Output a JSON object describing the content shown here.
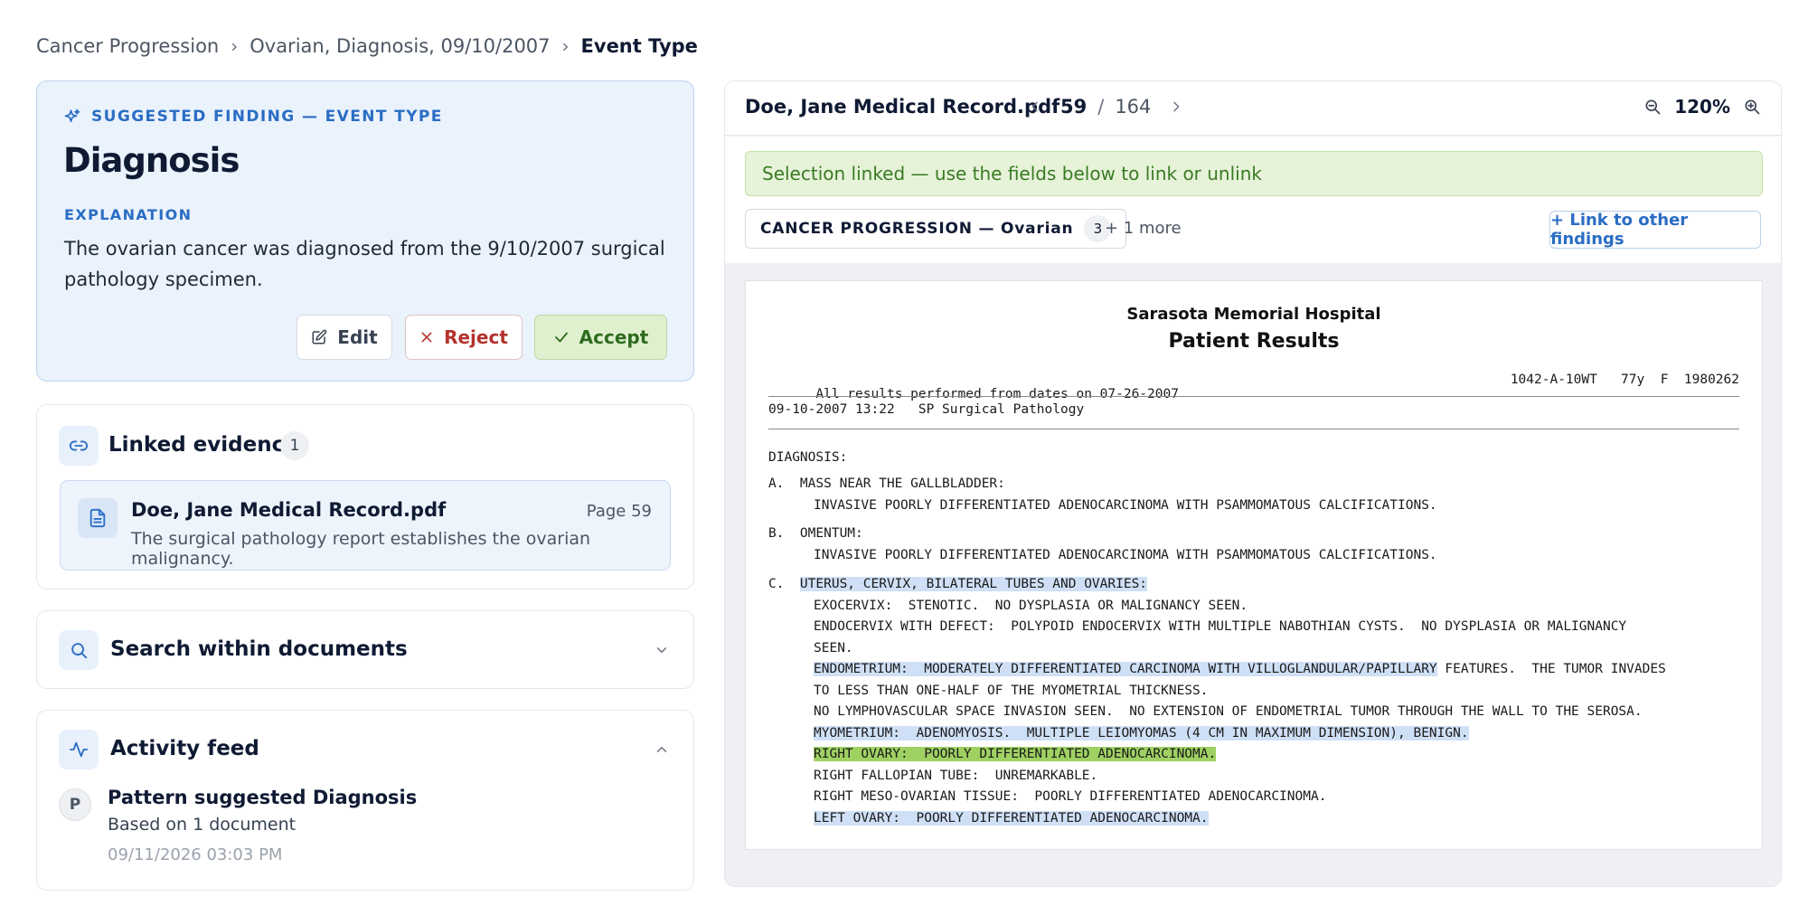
{
  "breadcrumb": {
    "items": [
      "Cancer Progression",
      "Ovarian, Diagnosis, 09/10/2007"
    ],
    "current": "Event Type"
  },
  "finding": {
    "tag": "SUGGESTED FINDING — EVENT TYPE",
    "title": "Diagnosis",
    "explanation_label": "EXPLANATION",
    "explanation": "The ovarian cancer was diagnosed from the 9/10/2007 surgical pathology specimen.",
    "actions": {
      "edit": "Edit",
      "reject": "Reject",
      "accept": "Accept"
    }
  },
  "linked_evidence": {
    "title": "Linked evidence",
    "count": "1",
    "item": {
      "file": "Doe, Jane Medical Record.pdf",
      "page": "Page 59",
      "description": "The surgical pathology report establishes the ovarian malignancy."
    }
  },
  "search": {
    "title": "Search within documents"
  },
  "activity": {
    "title": "Activity feed",
    "item": {
      "avatar": "P",
      "title": "Pattern suggested Diagnosis",
      "subtitle": "Based on 1 document",
      "time": "09/11/2026 03:03 PM"
    }
  },
  "viewer": {
    "file": "Doe, Jane Medical Record.pdf",
    "page_current": "59",
    "page_separator": "/",
    "page_total": "164",
    "zoom": "120%",
    "banner": "Selection linked — use the fields below to link or unlink",
    "chip_label": "CANCER PROGRESSION — Ovarian",
    "chip_count": "3",
    "more": "+ 1 more",
    "link_button": "+ Link to other findings"
  },
  "document": {
    "hospital": "Sarasota Memorial Hospital",
    "heading": "Patient Results",
    "header_left": "All results performed from dates on 07-26-2007",
    "header_right": "1042-A-10WT   77y  F  1980262",
    "header_line2": "09-10-2007 13:22   SP Surgical Pathology",
    "diagnosis_label": "DIAGNOSIS:",
    "a_label": "A.  MASS NEAR THE GALLBLADDER:",
    "a_text": "INVASIVE POORLY DIFFERENTIATED ADENOCARCINOMA WITH PSAMMOMATOUS CALCIFICATIONS.",
    "b_label": "B.  OMENTUM:",
    "b_text": "INVASIVE POORLY DIFFERENTIATED ADENOCARCINOMA WITH PSAMMOMATOUS CALCIFICATIONS.",
    "c_prefix": "C.  ",
    "c_label": "UTERUS, CERVIX, BILATERAL TUBES AND OVARIES:",
    "exocervix": "EXOCERVIX:  STENOTIC.  NO DYSPLASIA OR MALIGNANCY SEEN.",
    "endocervix_1": "ENDOCERVIX WITH DEFECT:  POLYPOID ENDOCERVIX WITH MULTIPLE NABOTHIAN CYSTS.  NO DYSPLASIA OR MALIGNANCY",
    "endocervix_2": "SEEN.",
    "endometrium_hl": "ENDOMETRIUM:  MODERATELY DIFFERENTIATED CARCINOMA WITH VILLOGLANDULAR/PAPILLARY",
    "endometrium_rest": " FEATURES.  THE TUMOR INVADES",
    "endometrium_2": "TO LESS THAN ONE-HALF OF THE MYOMETRIAL THICKNESS.",
    "lymph": "NO LYMPHOVASCULAR SPACE INVASION SEEN.  NO EXTENSION OF ENDOMETRIAL TUMOR THROUGH THE WALL TO THE SEROSA.",
    "myometrium": "MYOMETRIUM:  ADENOMYOSIS.  MULTIPLE LEIOMYOMAS (4 CM IN MAXIMUM DIMENSION), BENIGN.",
    "right_ovary": "RIGHT OVARY:  POORLY DIFFERENTIATED ADENOCARCINOMA.",
    "right_tube": "RIGHT FALLOPIAN TUBE:  UNREMARKABLE.",
    "right_meso": "RIGHT MESO-OVARIAN TISSUE:  POORLY DIFFERENTIATED ADENOCARCINOMA.",
    "left_ovary": "LEFT OVARY:  POORLY DIFFERENTIATED ADENOCARCINOMA."
  },
  "icons": {
    "breadcrumb_separator": "chevron-right-icon",
    "finding_tag": "sparkle-icon",
    "edit": "pencil-icon",
    "reject": "x-icon",
    "accept": "check-icon",
    "linked_evidence": "link-icon",
    "file": "file-text-icon",
    "search": "search-icon",
    "activity": "pulse-icon",
    "zoom_out": "zoom-out-icon",
    "zoom_in": "zoom-in-icon"
  },
  "colors": {
    "accent": "#2a6dc4",
    "accept": "#2f6b1e",
    "reject": "#b4322d",
    "highlight": "#cfe0f6",
    "highlight_active": "#9fd162"
  }
}
